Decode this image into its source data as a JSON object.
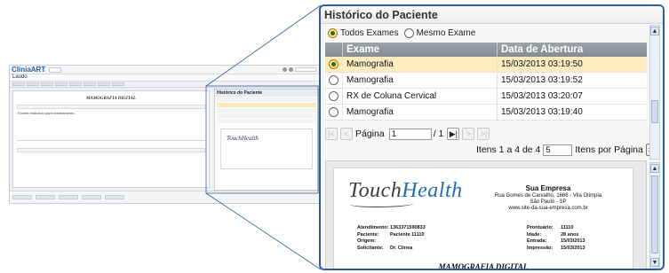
{
  "background_app": {
    "logo": "CliniaART",
    "section": "Laudo",
    "editor_title": "MAMOGRAFIA DIGITAL",
    "editor_text": "Exame realizado para rastreamento.",
    "side_title": "Histórico do Paciente"
  },
  "panel": {
    "title": "Histórico do Paciente",
    "filter": {
      "option_all": "Todos Exames",
      "option_same": "Mesmo Exame",
      "selected": "Todos Exames"
    },
    "table": {
      "headers": [
        "Exame",
        "Data de Abertura"
      ],
      "rows": [
        {
          "exam": "Mamografia",
          "date": "15/03/2013 03:19:50",
          "selected": true
        },
        {
          "exam": "Mamografia",
          "date": "15/03/2013 03:19:52",
          "selected": false
        },
        {
          "exam": "RX de Coluna Cervical",
          "date": "15/03/2013 03:20:07",
          "selected": false
        },
        {
          "exam": "Mamografia",
          "date": "15/03/2013 03:19:40",
          "selected": false
        }
      ]
    },
    "pager": {
      "label": "Página",
      "page": "1",
      "total": "/ 1",
      "items_info": "Itens 1 a 4 de 4",
      "per_page": "5",
      "per_page_label": "Itens por Página"
    },
    "document": {
      "logo_text": "Touch",
      "logo_accent": "Health",
      "company_name": "Sua Empresa",
      "company_address": "Rua Gomes de Carvalho, 1666 - Vila Olímpia",
      "company_city": "São Paulo - SP",
      "company_site": "www.site-da-sua-empresa.com.br",
      "left_fields": [
        {
          "label": "Atendimento:",
          "value": "1363371590833"
        },
        {
          "label": "Paciente:",
          "value": "Paciente 11110"
        },
        {
          "label": "Origem:",
          "value": ""
        },
        {
          "label": "Solicitante:",
          "value": "Dr. Clinea"
        }
      ],
      "right_fields": [
        {
          "label": "Prontuário:",
          "value": "11110"
        },
        {
          "label": "Idade:",
          "value": "28 anos"
        },
        {
          "label": "Entrada:",
          "value": "15/03/2013"
        },
        {
          "label": "Impressão:",
          "value": "15/03/2013"
        }
      ],
      "title": "MAMOGRAFIA DIGITAL"
    }
  }
}
